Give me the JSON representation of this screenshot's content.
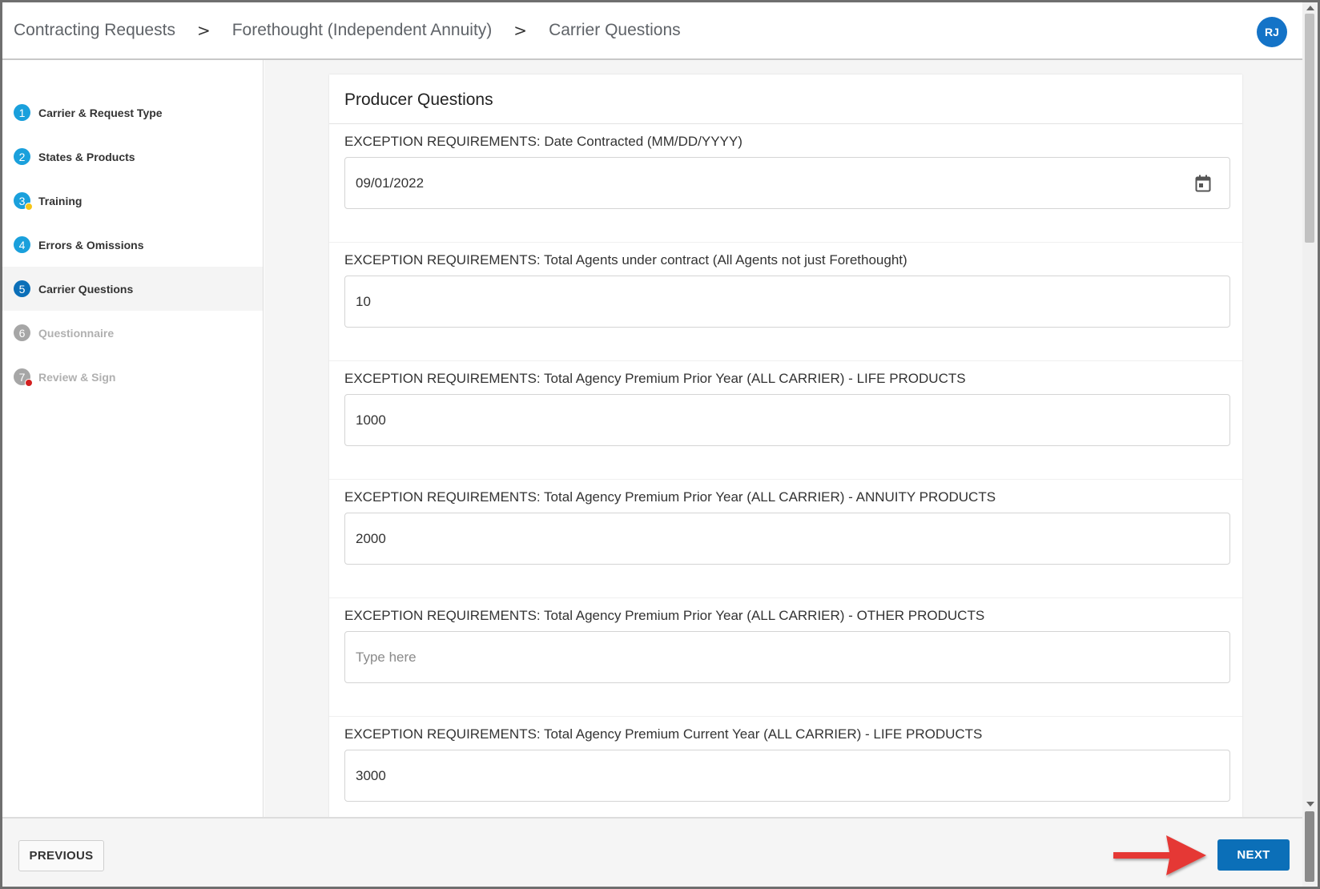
{
  "breadcrumb": {
    "items": [
      "Contracting Requests",
      "Forethought (Independent Annuity)",
      "Carrier Questions"
    ],
    "separator": ">"
  },
  "user": {
    "initials": "RJ"
  },
  "steps": [
    {
      "number": "1",
      "label": "Carrier & Request Type",
      "state": "complete"
    },
    {
      "number": "2",
      "label": "States & Products",
      "state": "complete"
    },
    {
      "number": "3",
      "label": "Training",
      "state": "warning"
    },
    {
      "number": "4",
      "label": "Errors & Omissions",
      "state": "complete"
    },
    {
      "number": "5",
      "label": "Carrier Questions",
      "state": "active"
    },
    {
      "number": "6",
      "label": "Questionnaire",
      "state": "disabled"
    },
    {
      "number": "7",
      "label": "Review & Sign",
      "state": "disabled-error"
    }
  ],
  "form": {
    "title": "Producer Questions",
    "questions": [
      {
        "label": "EXCEPTION REQUIREMENTS: Date Contracted (MM/DD/YYYY)",
        "value": "09/01/2022",
        "placeholder": "",
        "type": "date"
      },
      {
        "label": "EXCEPTION REQUIREMENTS: Total Agents under contract (All Agents not just Forethought)",
        "value": "10",
        "placeholder": "",
        "type": "text"
      },
      {
        "label": "EXCEPTION REQUIREMENTS: Total Agency Premium Prior Year (ALL CARRIER) - LIFE PRODUCTS",
        "value": "1000",
        "placeholder": "",
        "type": "text"
      },
      {
        "label": "EXCEPTION REQUIREMENTS: Total Agency Premium Prior Year (ALL CARRIER) - ANNUITY PRODUCTS",
        "value": "2000",
        "placeholder": "",
        "type": "text"
      },
      {
        "label": "EXCEPTION REQUIREMENTS: Total Agency Premium Prior Year (ALL CARRIER) - OTHER PRODUCTS",
        "value": "",
        "placeholder": "Type here",
        "type": "text"
      },
      {
        "label": "EXCEPTION REQUIREMENTS: Total Agency Premium Current Year (ALL CARRIER) - LIFE PRODUCTS",
        "value": "3000",
        "placeholder": "",
        "type": "text"
      }
    ]
  },
  "footer": {
    "previous_label": "PREVIOUS",
    "next_label": "NEXT"
  },
  "colors": {
    "primary": "#0b6fb8",
    "step_complete": "#1aa0dc",
    "step_disabled": "#a6a6a6",
    "warning": "#f5c518",
    "error": "#d32020",
    "annotation_arrow": "#e53935"
  },
  "icons": {
    "calendar": "calendar-icon",
    "breadcrumb_separator": "chevron-right-icon",
    "annotation": "red-arrow-pointer"
  }
}
